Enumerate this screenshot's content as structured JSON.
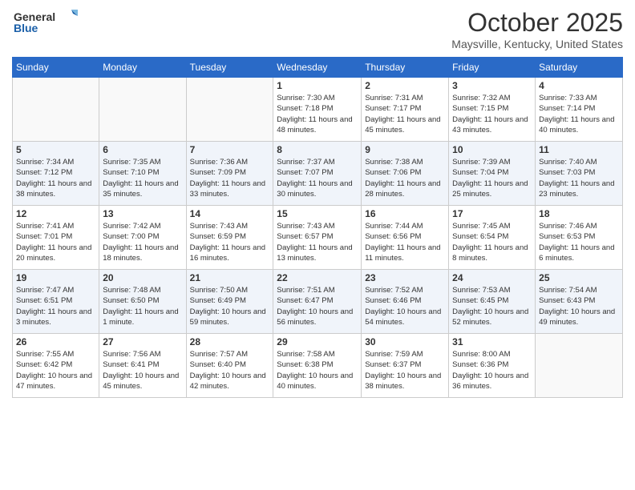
{
  "header": {
    "logo_general": "General",
    "logo_blue": "Blue",
    "month_title": "October 2025",
    "location": "Maysville, Kentucky, United States"
  },
  "weekdays": [
    "Sunday",
    "Monday",
    "Tuesday",
    "Wednesday",
    "Thursday",
    "Friday",
    "Saturday"
  ],
  "weeks": [
    [
      {
        "day": "",
        "info": ""
      },
      {
        "day": "",
        "info": ""
      },
      {
        "day": "",
        "info": ""
      },
      {
        "day": "1",
        "info": "Sunrise: 7:30 AM\nSunset: 7:18 PM\nDaylight: 11 hours\nand 48 minutes."
      },
      {
        "day": "2",
        "info": "Sunrise: 7:31 AM\nSunset: 7:17 PM\nDaylight: 11 hours\nand 45 minutes."
      },
      {
        "day": "3",
        "info": "Sunrise: 7:32 AM\nSunset: 7:15 PM\nDaylight: 11 hours\nand 43 minutes."
      },
      {
        "day": "4",
        "info": "Sunrise: 7:33 AM\nSunset: 7:14 PM\nDaylight: 11 hours\nand 40 minutes."
      }
    ],
    [
      {
        "day": "5",
        "info": "Sunrise: 7:34 AM\nSunset: 7:12 PM\nDaylight: 11 hours\nand 38 minutes."
      },
      {
        "day": "6",
        "info": "Sunrise: 7:35 AM\nSunset: 7:10 PM\nDaylight: 11 hours\nand 35 minutes."
      },
      {
        "day": "7",
        "info": "Sunrise: 7:36 AM\nSunset: 7:09 PM\nDaylight: 11 hours\nand 33 minutes."
      },
      {
        "day": "8",
        "info": "Sunrise: 7:37 AM\nSunset: 7:07 PM\nDaylight: 11 hours\nand 30 minutes."
      },
      {
        "day": "9",
        "info": "Sunrise: 7:38 AM\nSunset: 7:06 PM\nDaylight: 11 hours\nand 28 minutes."
      },
      {
        "day": "10",
        "info": "Sunrise: 7:39 AM\nSunset: 7:04 PM\nDaylight: 11 hours\nand 25 minutes."
      },
      {
        "day": "11",
        "info": "Sunrise: 7:40 AM\nSunset: 7:03 PM\nDaylight: 11 hours\nand 23 minutes."
      }
    ],
    [
      {
        "day": "12",
        "info": "Sunrise: 7:41 AM\nSunset: 7:01 PM\nDaylight: 11 hours\nand 20 minutes."
      },
      {
        "day": "13",
        "info": "Sunrise: 7:42 AM\nSunset: 7:00 PM\nDaylight: 11 hours\nand 18 minutes."
      },
      {
        "day": "14",
        "info": "Sunrise: 7:43 AM\nSunset: 6:59 PM\nDaylight: 11 hours\nand 16 minutes."
      },
      {
        "day": "15",
        "info": "Sunrise: 7:43 AM\nSunset: 6:57 PM\nDaylight: 11 hours\nand 13 minutes."
      },
      {
        "day": "16",
        "info": "Sunrise: 7:44 AM\nSunset: 6:56 PM\nDaylight: 11 hours\nand 11 minutes."
      },
      {
        "day": "17",
        "info": "Sunrise: 7:45 AM\nSunset: 6:54 PM\nDaylight: 11 hours\nand 8 minutes."
      },
      {
        "day": "18",
        "info": "Sunrise: 7:46 AM\nSunset: 6:53 PM\nDaylight: 11 hours\nand 6 minutes."
      }
    ],
    [
      {
        "day": "19",
        "info": "Sunrise: 7:47 AM\nSunset: 6:51 PM\nDaylight: 11 hours\nand 3 minutes."
      },
      {
        "day": "20",
        "info": "Sunrise: 7:48 AM\nSunset: 6:50 PM\nDaylight: 11 hours\nand 1 minute."
      },
      {
        "day": "21",
        "info": "Sunrise: 7:50 AM\nSunset: 6:49 PM\nDaylight: 10 hours\nand 59 minutes."
      },
      {
        "day": "22",
        "info": "Sunrise: 7:51 AM\nSunset: 6:47 PM\nDaylight: 10 hours\nand 56 minutes."
      },
      {
        "day": "23",
        "info": "Sunrise: 7:52 AM\nSunset: 6:46 PM\nDaylight: 10 hours\nand 54 minutes."
      },
      {
        "day": "24",
        "info": "Sunrise: 7:53 AM\nSunset: 6:45 PM\nDaylight: 10 hours\nand 52 minutes."
      },
      {
        "day": "25",
        "info": "Sunrise: 7:54 AM\nSunset: 6:43 PM\nDaylight: 10 hours\nand 49 minutes."
      }
    ],
    [
      {
        "day": "26",
        "info": "Sunrise: 7:55 AM\nSunset: 6:42 PM\nDaylight: 10 hours\nand 47 minutes."
      },
      {
        "day": "27",
        "info": "Sunrise: 7:56 AM\nSunset: 6:41 PM\nDaylight: 10 hours\nand 45 minutes."
      },
      {
        "day": "28",
        "info": "Sunrise: 7:57 AM\nSunset: 6:40 PM\nDaylight: 10 hours\nand 42 minutes."
      },
      {
        "day": "29",
        "info": "Sunrise: 7:58 AM\nSunset: 6:38 PM\nDaylight: 10 hours\nand 40 minutes."
      },
      {
        "day": "30",
        "info": "Sunrise: 7:59 AM\nSunset: 6:37 PM\nDaylight: 10 hours\nand 38 minutes."
      },
      {
        "day": "31",
        "info": "Sunrise: 8:00 AM\nSunset: 6:36 PM\nDaylight: 10 hours\nand 36 minutes."
      },
      {
        "day": "",
        "info": ""
      }
    ]
  ]
}
